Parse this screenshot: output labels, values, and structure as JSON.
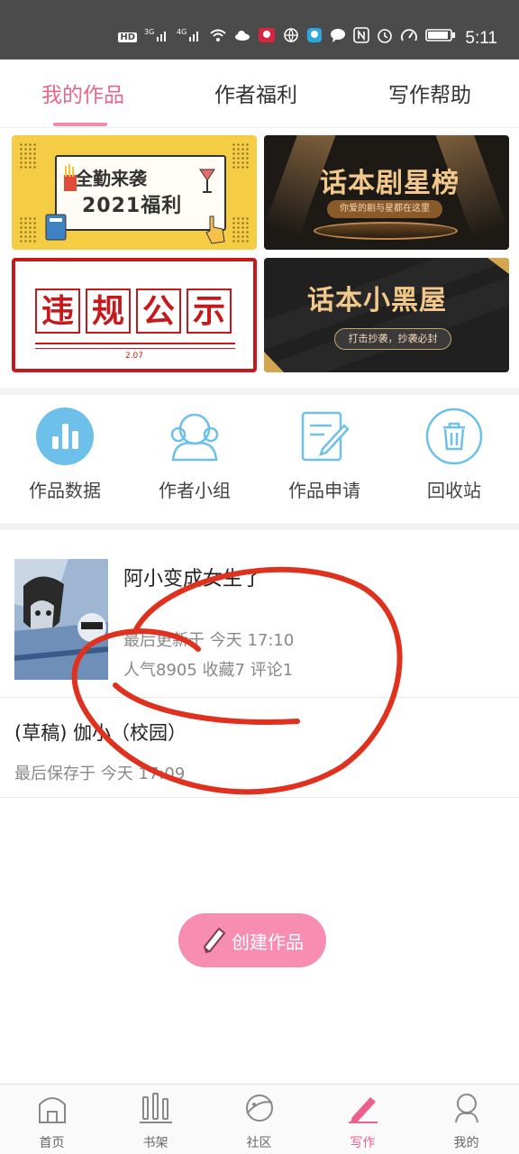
{
  "status_bar": {
    "time": "5:11",
    "icons": [
      "hd-icon",
      "signal-3g-icon",
      "signal-4g-icon",
      "wifi-icon",
      "cloud-icon",
      "app-icon",
      "globe-icon",
      "bulb-icon",
      "chat-icon",
      "nfc-icon",
      "alarm-icon",
      "speed-icon",
      "battery-icon"
    ],
    "hd_label": "HD",
    "net1": "3G",
    "net2": "4G"
  },
  "tabs": [
    {
      "label": "我的作品",
      "active": true
    },
    {
      "label": "作者福利",
      "active": false
    },
    {
      "label": "写作帮助",
      "active": false
    }
  ],
  "banners": {
    "b1": {
      "line1": "全勤来袭",
      "line2": "2021福利"
    },
    "b2": {
      "title": "话本剧星榜",
      "subtitle": "你爱的剧与星都在这里"
    },
    "b3": {
      "chars": [
        "违",
        "规",
        "公",
        "示"
      ],
      "date": "2.07"
    },
    "b4": {
      "title": "话本小黑屋",
      "subtitle": "打击抄袭，抄袭必封"
    }
  },
  "shortcuts": [
    {
      "label": "作品数据",
      "icon": "bar-chart-icon"
    },
    {
      "label": "作者小组",
      "icon": "group-icon"
    },
    {
      "label": "作品申请",
      "icon": "edit-form-icon"
    },
    {
      "label": "回收站",
      "icon": "trash-icon"
    }
  ],
  "works": [
    {
      "title": "阿小变成女生了",
      "updated": "最后更新于 今天 17:10",
      "stats": "人气8905 收藏7 评论1"
    },
    {
      "title": "(草稿) 伽小（校园）",
      "saved": "最后保存于 今天 17:09"
    }
  ],
  "create_button": {
    "label": "创建作品"
  },
  "bottom_nav": [
    {
      "label": "首页",
      "icon": "home-icon",
      "active": false
    },
    {
      "label": "书架",
      "icon": "bookshelf-icon",
      "active": false
    },
    {
      "label": "社区",
      "icon": "planet-icon",
      "active": false
    },
    {
      "label": "写作",
      "icon": "pen-icon",
      "active": true
    },
    {
      "label": "我的",
      "icon": "profile-icon",
      "active": false
    }
  ],
  "colors": {
    "accent": "#e8668a",
    "create_button": "#f78db1",
    "icon_blue": "#6cc0ea",
    "annotation": "#e0301e"
  }
}
